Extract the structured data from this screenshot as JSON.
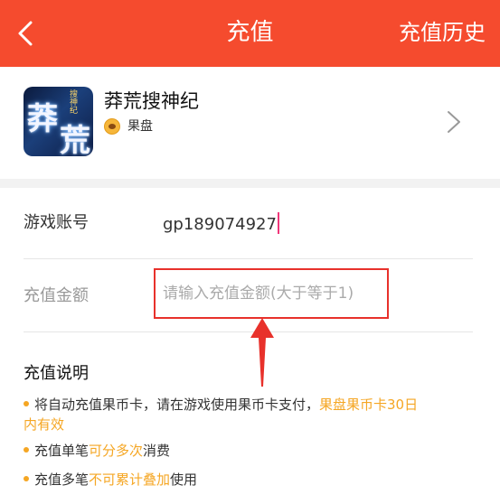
{
  "header": {
    "title": "充值",
    "history_label": "充值历史"
  },
  "game": {
    "name": "莽荒搜神纪",
    "icon_text_1": "莽",
    "icon_text_2": "荒",
    "icon_tag": "搜神纪",
    "platform": "果盘"
  },
  "form": {
    "account_label": "游戏账号",
    "account_value": "gp189074927",
    "amount_label": "充值金额",
    "amount_placeholder": "请输入充值金额(大于等于1)"
  },
  "notes": {
    "title": "充值说明",
    "note1_a": "将自动充值果币卡，请在游戏使用果币卡支付，",
    "note1_hl1": "果盘果币卡30日",
    "note1_hl2": "内有效",
    "note2_a": "充值单笔",
    "note2_hl": "可分多次",
    "note2_b": "消费",
    "note3_a": "充值多笔",
    "note3_hl": "不可累计叠加",
    "note3_b": "使用"
  },
  "colors": {
    "header_bg": "#f54b2e",
    "highlight": "#f5a623",
    "annotation_red": "#e8312b"
  },
  "icons": [
    "back-arrow-icon",
    "chevron-right-icon",
    "platform-logo-icon"
  ]
}
